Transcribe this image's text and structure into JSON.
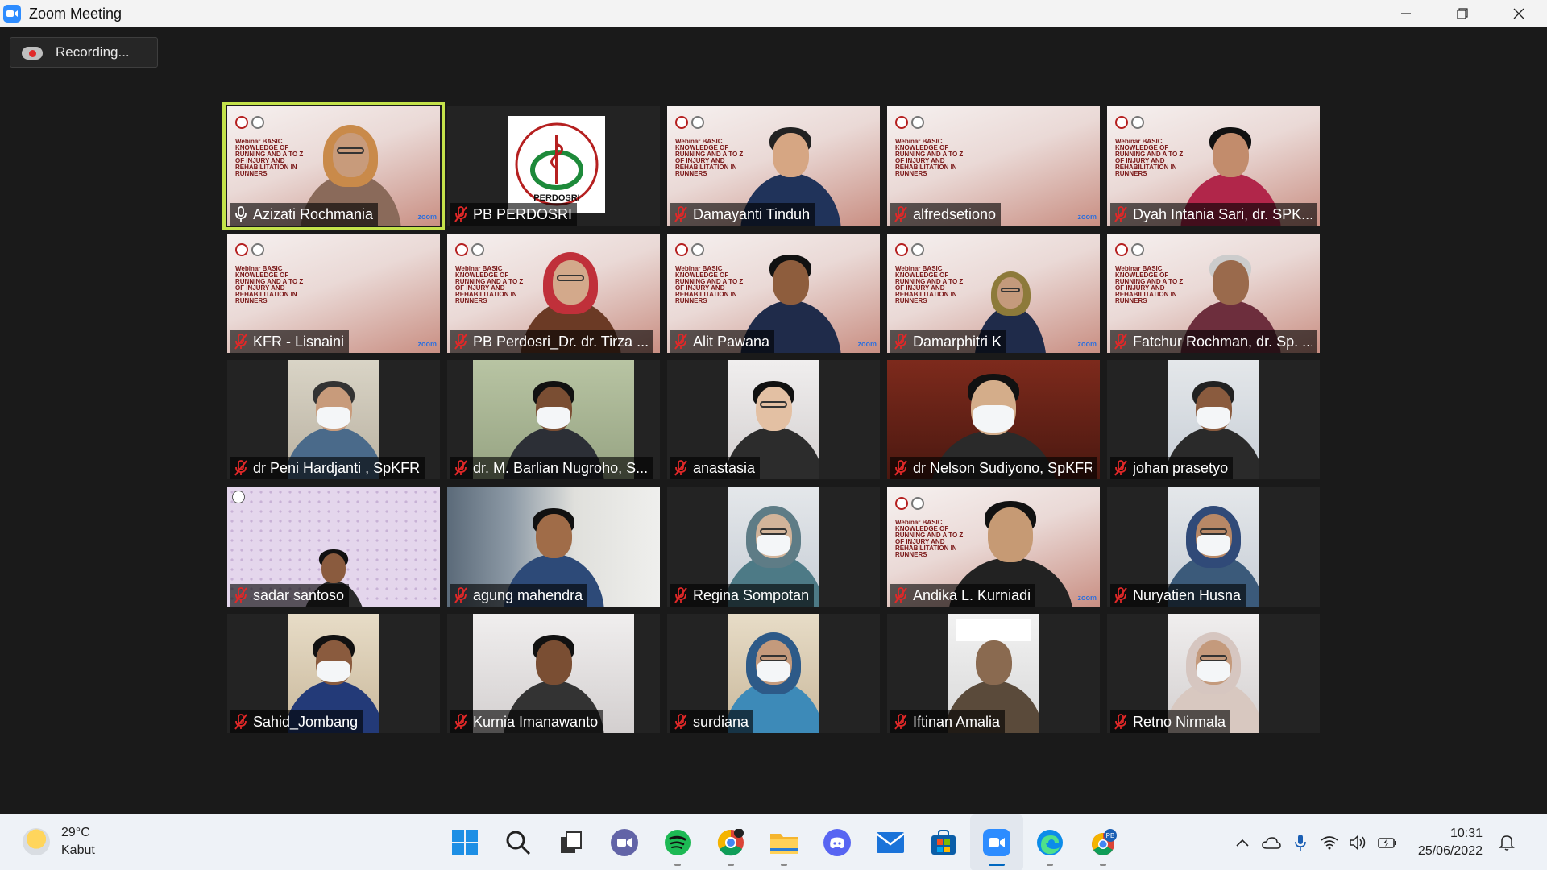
{
  "window": {
    "title": "Zoom Meeting",
    "controls": [
      "minimize",
      "restore",
      "close"
    ]
  },
  "recording": {
    "label": "Recording..."
  },
  "participants": [
    {
      "name": "Azizati Rochmania",
      "muted": false,
      "active_speaker": true
    },
    {
      "name": "PB PERDOSRI",
      "muted": true
    },
    {
      "name": "Damayanti Tinduh",
      "muted": true
    },
    {
      "name": "alfredsetiono",
      "muted": true
    },
    {
      "name": "Dyah Intania Sari, dr. SPK...",
      "muted": true
    },
    {
      "name": "KFR - Lisnaini",
      "muted": true
    },
    {
      "name": "PB Perdosri_Dr. dr. Tirza ...",
      "muted": true
    },
    {
      "name": "Alit Pawana",
      "muted": true
    },
    {
      "name": "Damarphitri K",
      "muted": true
    },
    {
      "name": "Fatchur Rochman, dr. Sp. ...",
      "muted": true
    },
    {
      "name": "dr Peni Hardjanti , SpKFR",
      "muted": true
    },
    {
      "name": "dr. M. Barlian Nugroho, S...",
      "muted": true
    },
    {
      "name": "anastasia",
      "muted": true
    },
    {
      "name": "dr Nelson Sudiyono, SpKFR",
      "muted": true
    },
    {
      "name": "johan prasetyo",
      "muted": true
    },
    {
      "name": "sadar santoso",
      "muted": true
    },
    {
      "name": "agung mahendra",
      "muted": true
    },
    {
      "name": "Regina Sompotan",
      "muted": true
    },
    {
      "name": "Andika L. Kurniadi",
      "muted": true
    },
    {
      "name": "Nuryatien Husna",
      "muted": true
    },
    {
      "name": "Sahid_Jombang",
      "muted": true
    },
    {
      "name": "Kurnia Imanawanto",
      "muted": true
    },
    {
      "name": "surdiana",
      "muted": true
    },
    {
      "name": "Iftinan Amalia",
      "muted": true
    },
    {
      "name": "Retno Nirmala",
      "muted": true
    }
  ],
  "webinar_bg": {
    "text": "Webinar BASIC KNOWLEDGE OF RUNNING AND A TO Z OF INJURY AND REHABILITATION IN RUNNERS",
    "watermark": "zoom"
  },
  "pb_logo_text": "PERDOSRI",
  "taskbar": {
    "weather": {
      "temp": "29°C",
      "condition": "Kabut"
    },
    "apps": [
      "windows-start",
      "search",
      "task-view",
      "teams-chat",
      "spotify",
      "chrome",
      "file-explorer",
      "discord",
      "mail",
      "microsoft-store",
      "zoom",
      "edge",
      "chrome-profile"
    ],
    "clock": {
      "time": "10:31",
      "date": "25/06/2022"
    }
  },
  "colors": {
    "active_speaker_border": "#c4e24a",
    "muted_icon": "#e02828",
    "zoom_blue": "#2d8cff"
  }
}
